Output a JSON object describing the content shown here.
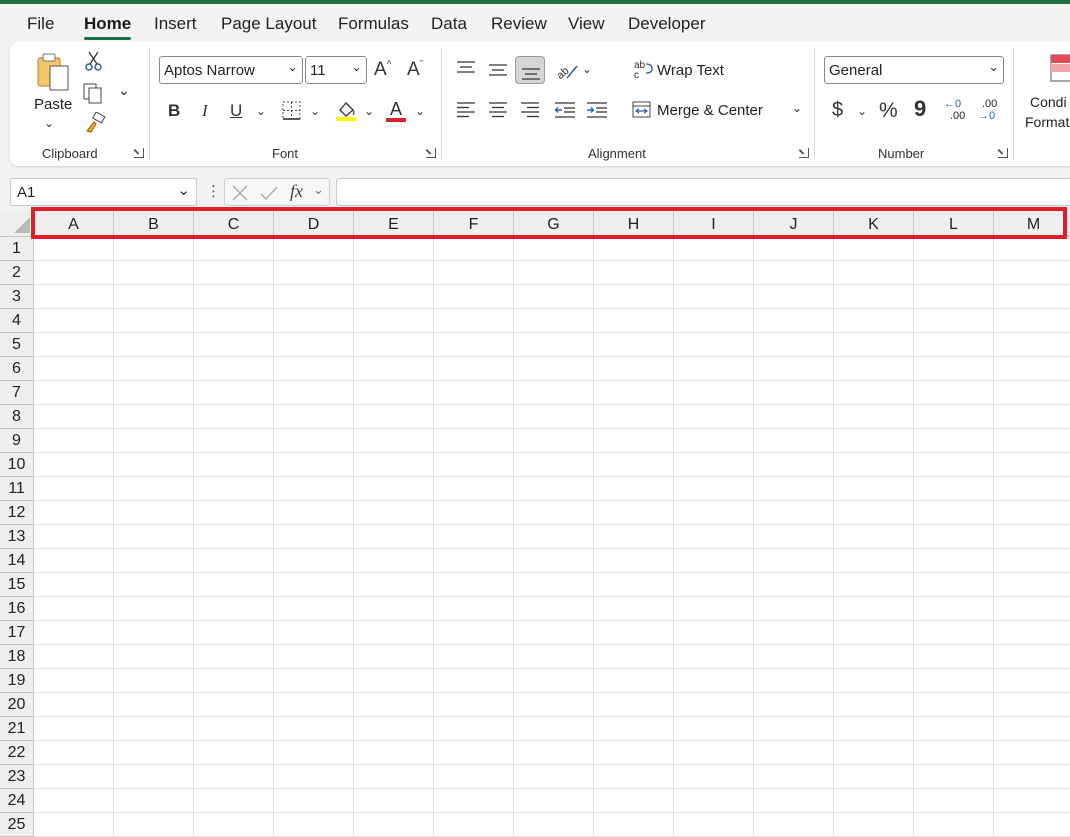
{
  "menu": {
    "tabs": [
      {
        "label": "File"
      },
      {
        "label": "Home"
      },
      {
        "label": "Insert"
      },
      {
        "label": "Page Layout"
      },
      {
        "label": "Formulas"
      },
      {
        "label": "Data"
      },
      {
        "label": "Review"
      },
      {
        "label": "View"
      },
      {
        "label": "Developer"
      }
    ],
    "active": "Home"
  },
  "clipboard": {
    "paste_label": "Paste",
    "group_label": "Clipboard"
  },
  "font": {
    "name": "Aptos Narrow",
    "size": "11",
    "group_label": "Font",
    "bold": "B",
    "italic": "I",
    "underline": "U",
    "grow": "A",
    "shrink": "A",
    "font_color_glyph": "A"
  },
  "alignment": {
    "wrap_text": "Wrap Text",
    "merge_center": "Merge & Center",
    "group_label": "Alignment"
  },
  "number": {
    "format": "General",
    "currency": "$",
    "percent": "%",
    "comma": "9",
    "inc_decimal": ".00",
    "dec_decimal": ".00",
    "group_label": "Number"
  },
  "styles": {
    "conditional_line1": "Condi",
    "conditional_line2": "Format"
  },
  "formula_bar": {
    "name_box": "A1",
    "fx": "fx",
    "value": ""
  },
  "sheet": {
    "columns": [
      "A",
      "B",
      "C",
      "D",
      "E",
      "F",
      "G",
      "H",
      "I",
      "J",
      "K",
      "L",
      "M"
    ],
    "rows": [
      "1",
      "2",
      "3",
      "4",
      "5",
      "6",
      "7",
      "8",
      "9",
      "10",
      "11",
      "12",
      "13",
      "14",
      "15",
      "16",
      "17",
      "18",
      "19",
      "20",
      "21",
      "22",
      "23",
      "24",
      "25"
    ]
  },
  "colors": {
    "accent": "#1e7145",
    "highlight": "#e11d2a",
    "fill_yellow": "#ffff00",
    "font_red": "#e11d2a"
  }
}
